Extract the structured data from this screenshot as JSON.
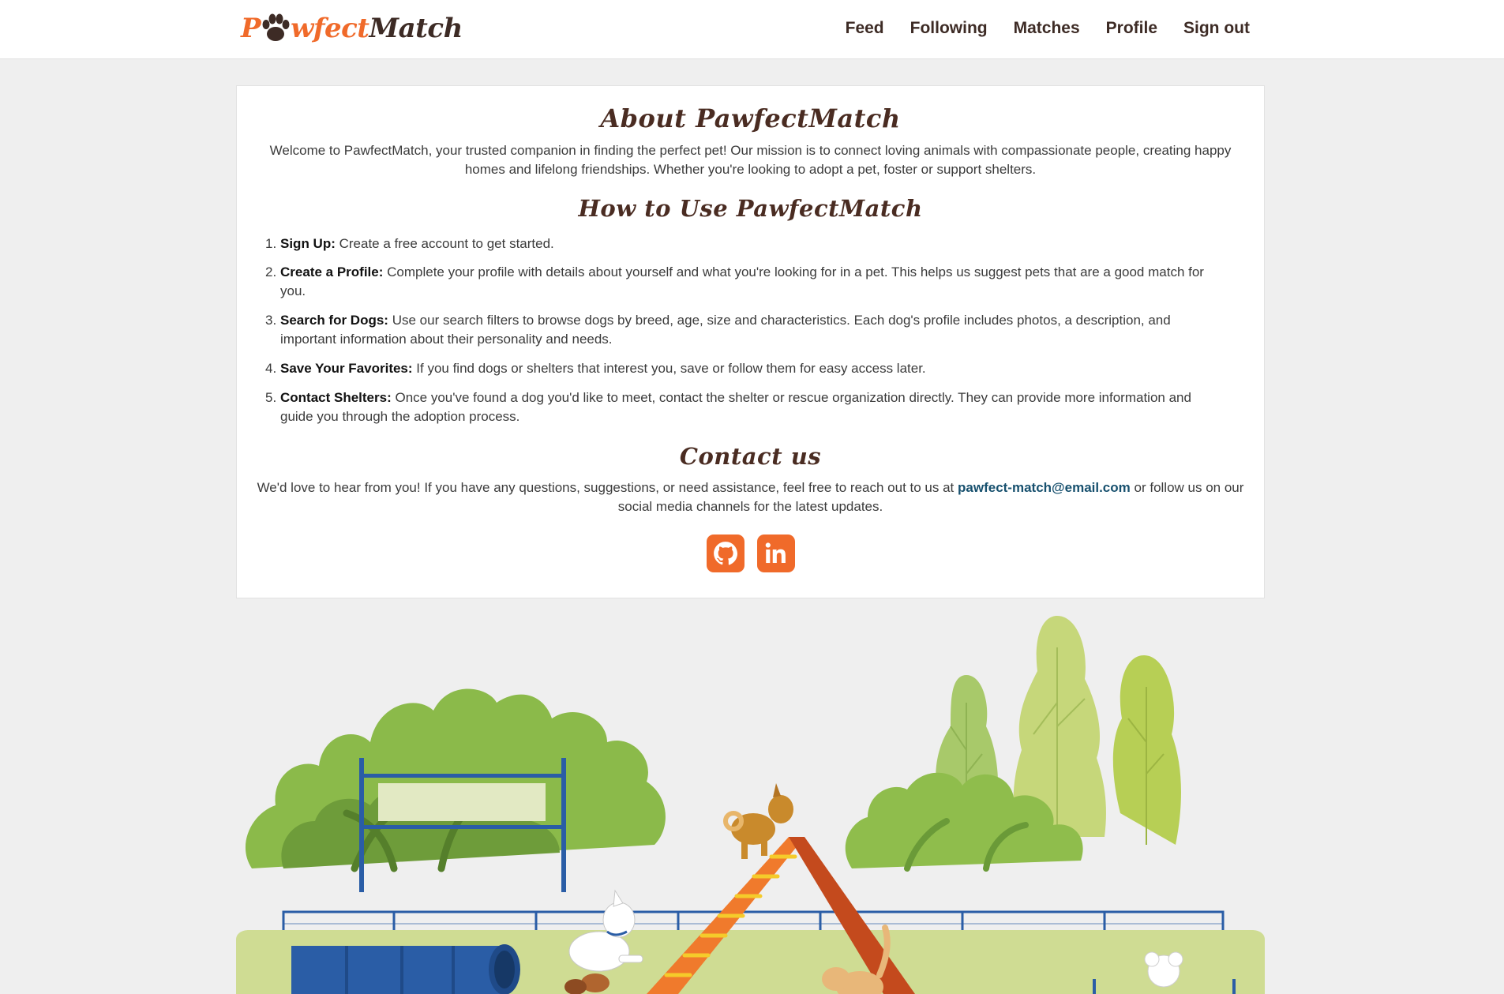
{
  "header": {
    "logo": {
      "part1": "P",
      "part2": "wfect",
      "part3": "Match"
    },
    "nav": [
      "Feed",
      "Following",
      "Matches",
      "Profile",
      "Sign out"
    ]
  },
  "about": {
    "title": "About PawfectMatch",
    "intro": "Welcome to PawfectMatch, your trusted companion in finding the perfect pet! Our mission is to connect loving animals with compassionate people, creating happy homes and lifelong friendships. Whether you're looking to adopt a pet, foster or support shelters."
  },
  "howto": {
    "title": "How to Use PawfectMatch",
    "steps": [
      {
        "num": "1.",
        "label": "Sign Up:",
        "text": " Create a free account to get started."
      },
      {
        "num": "2.",
        "label": "Create a Profile:",
        "text": " Complete your profile with details about yourself and what you're looking for in a pet. This helps us suggest pets that are a good match for you."
      },
      {
        "num": "3.",
        "label": "Search for Dogs:",
        "text": " Use our search filters to browse dogs by breed, age, size and characteristics. Each dog's profile includes photos, a description, and important information about their personality and needs."
      },
      {
        "num": "4.",
        "label": "Save Your Favorites:",
        "text": " If you find dogs or shelters that interest you, save or follow them for easy access later."
      },
      {
        "num": "5.",
        "label": "Contact Shelters:",
        "text": " Once you've found a dog you'd like to meet, contact the shelter or rescue organization directly. They can provide more information and guide you through the adoption process."
      }
    ]
  },
  "contact": {
    "title": "Contact us",
    "before": "We'd love to hear from you! If you have any questions, suggestions, or need assistance, feel free to reach out to us at ",
    "email": "pawfect-match@email.com",
    "after": " or follow us on our social media channels for the latest updates.",
    "socials": [
      "github-icon",
      "linkedin-icon"
    ],
    "accent": "#f06a2a"
  }
}
